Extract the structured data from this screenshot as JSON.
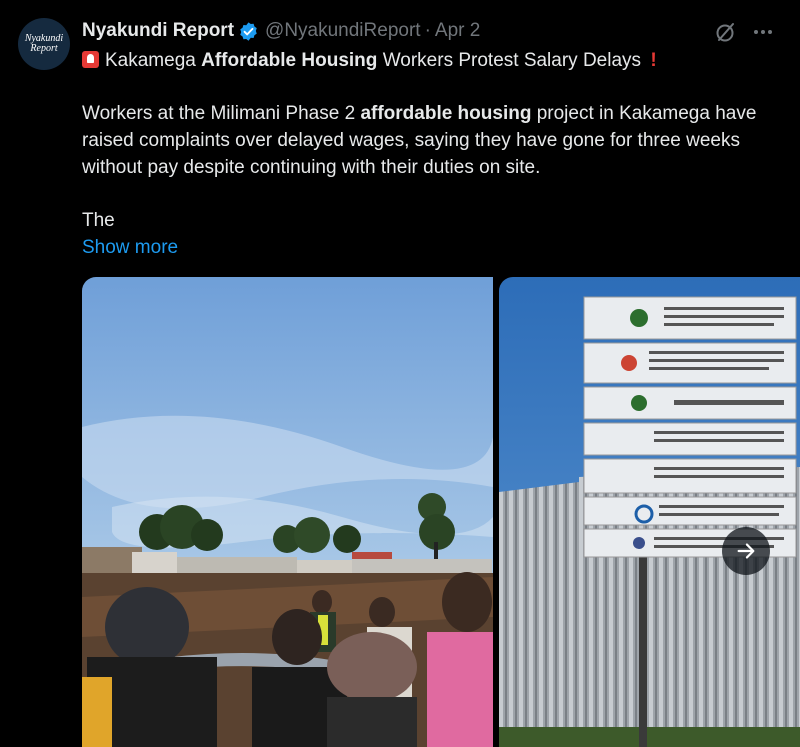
{
  "author": {
    "avatar_line1": "Nyakundi",
    "avatar_line2": "Report",
    "display_name": "Nyakundi Report",
    "handle": "@NyakundiReport",
    "separator": "·",
    "date": "Apr 2",
    "verified_color": "#1d9bf0"
  },
  "icons": {
    "grok": "grok-icon",
    "more": "more-icon",
    "siren": "siren-icon",
    "exclaim": "exclamation-icon",
    "next": "arrow-right-icon"
  },
  "headline": {
    "part1": "Kakamega",
    "bold": "Affordable Housing",
    "part2": "Workers Protest Salary Delays",
    "exclaim": "!"
  },
  "body": {
    "part1": "Workers at the Milimani Phase 2 ",
    "bold": "affordable housing",
    "part2": " project in Kakamega have raised complaints over delayed wages, saying they have gone for three weeks without pay despite continuing with their duties on site.",
    "truncated": "The",
    "show_more": "Show more"
  },
  "media": {
    "photos": [
      "construction-site-photo",
      "project-signboard-photo"
    ],
    "signboard_rows": [
      "PRINCIPAL SECRETARY STATE DEPARTMENT FOR HOUSING AND URBAN DEVELOPMENT",
      "PROPOSED CONSTRUCTION AND FINISHES OF BOMA YANGU",
      "THE GOVERNMENT OF KENYA",
      "HOUSING SECRETARY STATE DEPARTMENT FOR HOUSING AND URBAN DEVELOPMENT",
      "DIRECTOR - HOUSING DEPARTMENT",
      "EDON CONSULTANTS INTERNATIONAL LTD",
      "SHYAM GENERAL MERCHANTS LTD"
    ]
  },
  "colors": {
    "background": "#000000",
    "text": "#e7e9ea",
    "muted": "#71767b",
    "link": "#1d9bf0",
    "alert": "#e53935"
  }
}
